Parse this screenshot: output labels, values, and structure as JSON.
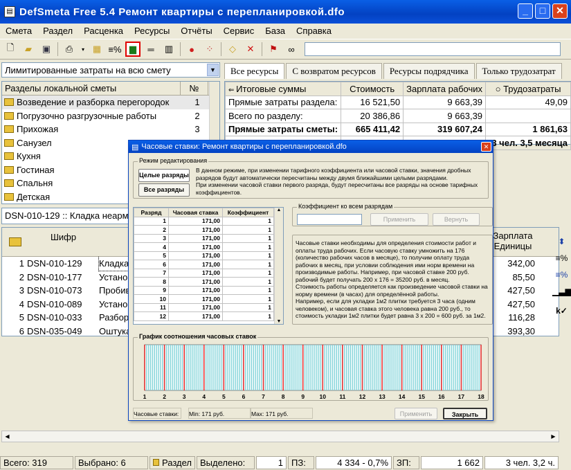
{
  "window": {
    "title": "DefSmeta Free 5.4   Ремонт квартиры с перепланировкой.dfo",
    "min": "_",
    "max": "□",
    "close": "✕"
  },
  "menu": [
    "Смета",
    "Раздел",
    "Расценка",
    "Ресурсы",
    "Отчёты",
    "Сервис",
    "База",
    "Справка"
  ],
  "combo": {
    "value": "Лимитированные затраты на всю смету"
  },
  "tabs": [
    "Все ресурсы",
    "С возвратом ресурсов",
    "Ресурсы подрядчика",
    "Только трудозатрат"
  ],
  "sections": {
    "header": "Разделы локальной сметы",
    "num_header": "№",
    "items": [
      {
        "name": "Возведение и разборка перегородок",
        "num": "1"
      },
      {
        "name": "Погрузочно разгрузочные работы",
        "num": "2"
      },
      {
        "name": "Прихожая",
        "num": "3"
      },
      {
        "name": "Санузел",
        "num": ""
      },
      {
        "name": "Кухня",
        "num": ""
      },
      {
        "name": "Гостиная",
        "num": ""
      },
      {
        "name": "Спальня",
        "num": ""
      },
      {
        "name": "Детская",
        "num": ""
      }
    ]
  },
  "totals": {
    "headers": [
      "Итоговые суммы",
      "Стоимость",
      "Зарплата рабочих",
      "Трудозатраты"
    ],
    "rows": [
      {
        "label": "Прямые затраты раздела:",
        "cost": "16 521,50",
        "wage": "9 663,39",
        "labor": "49,09"
      },
      {
        "label": "Всего по разделу:",
        "cost": "20 386,86",
        "wage": "9 663,39",
        "labor": ""
      },
      {
        "label": "Прямые затраты сметы:",
        "cost": "665 411,42",
        "wage": "319 607,24",
        "labor": "1 861,63"
      },
      {
        "label": "",
        "cost": "",
        "wage": "",
        "labor": "3 чел.  3,5 месяца"
      }
    ]
  },
  "info_line": "DSN-010-129  ::  Кладка неарм",
  "rates_table": {
    "headers": [
      "Шифр",
      "Зарплата Единицы"
    ],
    "rows": [
      {
        "n": "1",
        "code": "DSN-010-129",
        "name": "Кладка",
        "wage": "342,00"
      },
      {
        "n": "2",
        "code": "DSN-010-177",
        "name": "Устано",
        "wage": "85,50"
      },
      {
        "n": "3",
        "code": "DSN-010-073",
        "name": "Пробив",
        "wage": "427,50"
      },
      {
        "n": "4",
        "code": "DSN-010-089",
        "name": "Устано",
        "wage": "427,50"
      },
      {
        "n": "5",
        "code": "DSN-010-033",
        "name": "Разбор",
        "wage": "116,28"
      },
      {
        "n": "6",
        "code": "DSN-035-049",
        "name": "Оштука",
        "wage": "393,30"
      }
    ]
  },
  "status": {
    "total": "Всего: 319",
    "selected": "Выбрано: 6",
    "section": "Раздел",
    "highlighted": "Выделено:",
    "highlighted_val": "1",
    "pz": "ПЗ:",
    "pz_val": "4 334 - 0,7%",
    "zp": "ЗП:",
    "zp_val": "1 662",
    "people": "3 чел.  3,2 ч."
  },
  "dialog": {
    "title": "Часовые ставки:  Ремонт квартиры с перепланировкой.dfo",
    "mode_legend": "Режим редактирования",
    "btn_whole": "Целые разряды",
    "btn_all": "Все разряды",
    "mode_text": "В данном режиме, при изменении тарифного коэффициента или часовой ставки, значения дробных разрядов будут автоматически пересчитаны между двумя ближайшими целыми разрядами.\nПри изменении часовой ставки первого разряда, будут пересчитаны все разряды на основе тарифных коэффициентов.",
    "grid_headers": [
      "Разряд",
      "Часовая ставка",
      "Коэффициент"
    ],
    "grid_rows": [
      {
        "r": "1",
        "rate": "171,00",
        "k": "1"
      },
      {
        "r": "2",
        "rate": "171,00",
        "k": "1"
      },
      {
        "r": "3",
        "rate": "171,00",
        "k": "1"
      },
      {
        "r": "4",
        "rate": "171,00",
        "k": "1"
      },
      {
        "r": "5",
        "rate": "171,00",
        "k": "1"
      },
      {
        "r": "6",
        "rate": "171,00",
        "k": "1"
      },
      {
        "r": "7",
        "rate": "171,00",
        "k": "1"
      },
      {
        "r": "8",
        "rate": "171,00",
        "k": "1"
      },
      {
        "r": "9",
        "rate": "171,00",
        "k": "1"
      },
      {
        "r": "10",
        "rate": "171,00",
        "k": "1"
      },
      {
        "r": "11",
        "rate": "171,00",
        "k": "1"
      },
      {
        "r": "12",
        "rate": "171,00",
        "k": "1"
      }
    ],
    "coef_legend": "Коэффициент ко всем разрядам",
    "apply": "Применить",
    "revert": "Вернуть",
    "help_text": "Часовые ставки необходимы для определения стоимости работ и оплаты труда рабочих. Если часовую ставку умножить на 176 (количество рабочих часов в месяце), то получим оплату труда рабочих в месяц, при условии соблюдения ими норм времени на производимые работы. Например, при часовой ставке 200 руб. рабочий будет получать 200 х 176 = 35200 руб. в месяц.\nСтоимость работы определяется как произведение часовой ставки на норму времени (в часах) для определённой работы.\nНапример, если для укладки 1м2 плитки требуется 3 часа (одним человеком), и часовая ставка этого человека равна 200 руб., то стоимость укладки 1м2 плитки будет равна 3 х 200 = 600 руб. за 1м2.",
    "chart_legend": "График соотношения часовых ставок",
    "footer_label": "Часовые ставки:",
    "footer_min": "Min: 171 руб.",
    "footer_max": "Max: 171 руб.",
    "btn_apply2": "Применить",
    "btn_close": "Закрыть"
  },
  "chart_data": {
    "type": "bar",
    "categories": [
      "1",
      "2",
      "3",
      "4",
      "5",
      "6",
      "7",
      "8",
      "9",
      "10",
      "11",
      "12",
      "13",
      "14",
      "15",
      "16",
      "17",
      "18"
    ],
    "values": [
      171,
      171,
      171,
      171,
      171,
      171,
      171,
      171,
      171,
      171,
      171,
      171,
      171,
      171,
      171,
      171,
      171,
      171
    ],
    "ylim": [
      0,
      171
    ],
    "colors": {
      "bar": "#7fd3d8",
      "major": "#e03030"
    }
  }
}
